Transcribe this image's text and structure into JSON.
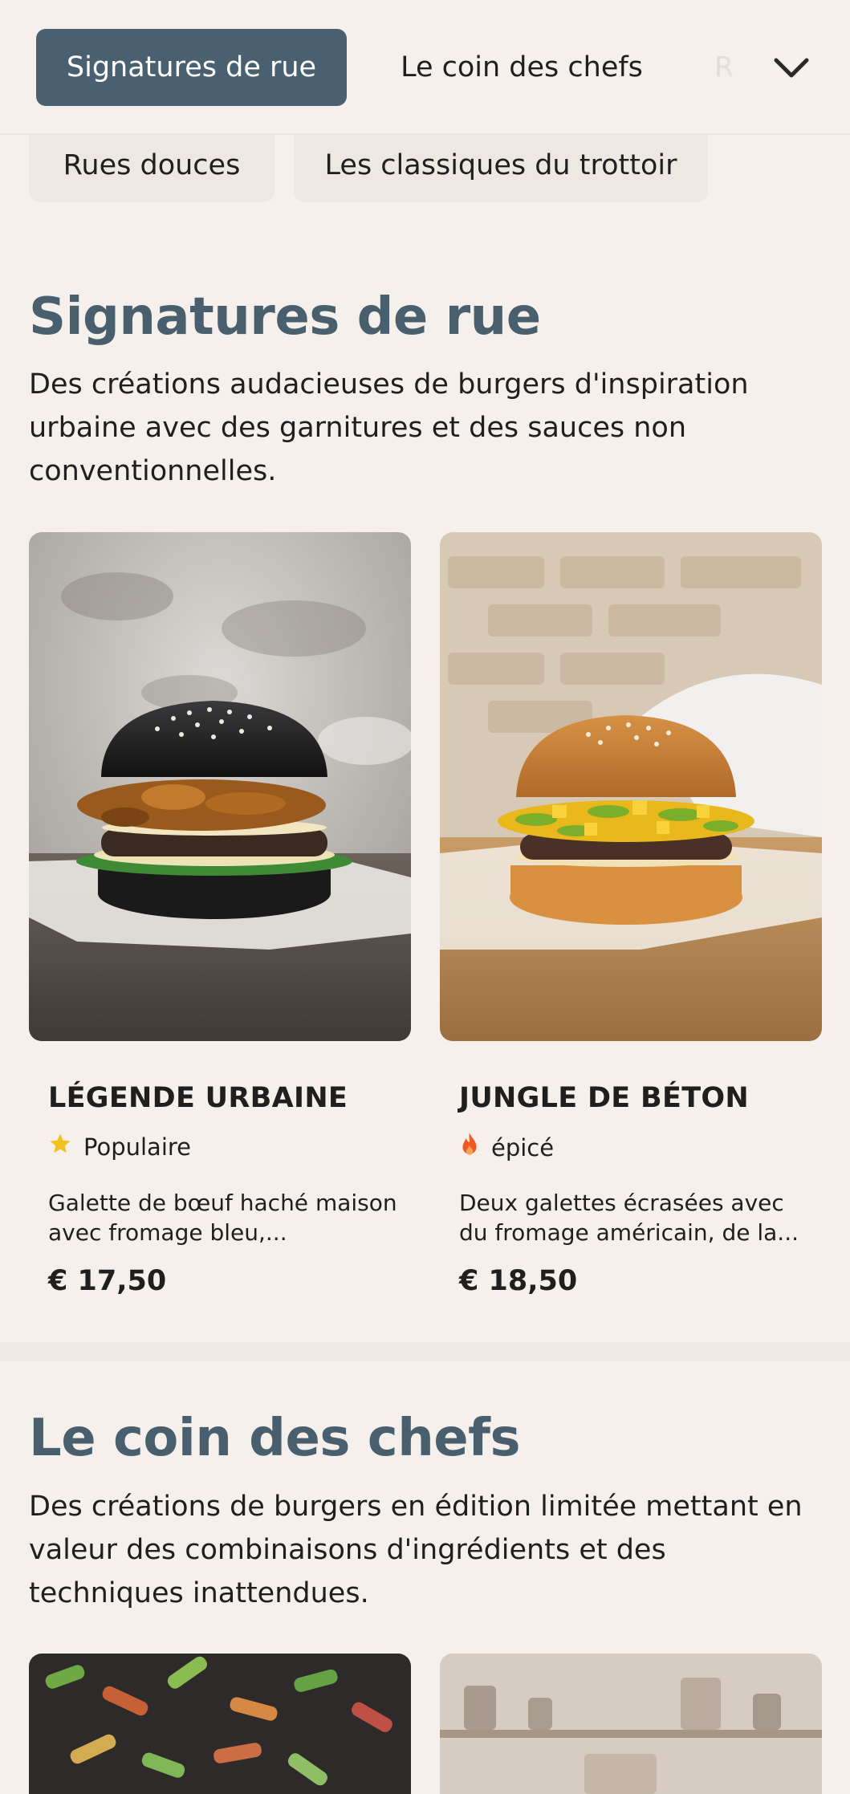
{
  "nav": {
    "tabs": [
      {
        "label": "Signatures de rue",
        "active": true
      },
      {
        "label": "Le coin des chefs",
        "active": false
      },
      {
        "label": "R",
        "active": false
      }
    ],
    "chips": [
      {
        "label": "Rues douces"
      },
      {
        "label": "Les classiques du trottoir"
      }
    ],
    "expand_icon": "chevron-down-icon",
    "active_color": "#48606f"
  },
  "sections": [
    {
      "title": "Signatures de rue",
      "description": "Des créations audacieuses de burgers d'inspiration urbaine avec des garnitures et des sauces non conventionnelles.",
      "items": [
        {
          "name": "LÉGENDE URBAINE",
          "tag": "Populaire",
          "tag_icon": "star-icon",
          "description": "Galette de bœuf haché maison avec fromage bleu,...",
          "price": "€ 17,50"
        },
        {
          "name": "JUNGLE DE BÉTON",
          "tag": "épicé",
          "tag_icon": "flame-icon",
          "description": "Deux galettes écrasées avec du fromage américain, de la...",
          "price": "€ 18,50"
        }
      ]
    },
    {
      "title": "Le coin des chefs",
      "description": "Des créations de burgers en édition limitée mettant en valeur des combinaisons d'ingrédients et des techniques inattendues."
    }
  ],
  "colors": {
    "background": "#f6f0ec",
    "heading": "#4a5f6d",
    "star": "#f2c21b",
    "flame": "#ef5a23"
  }
}
